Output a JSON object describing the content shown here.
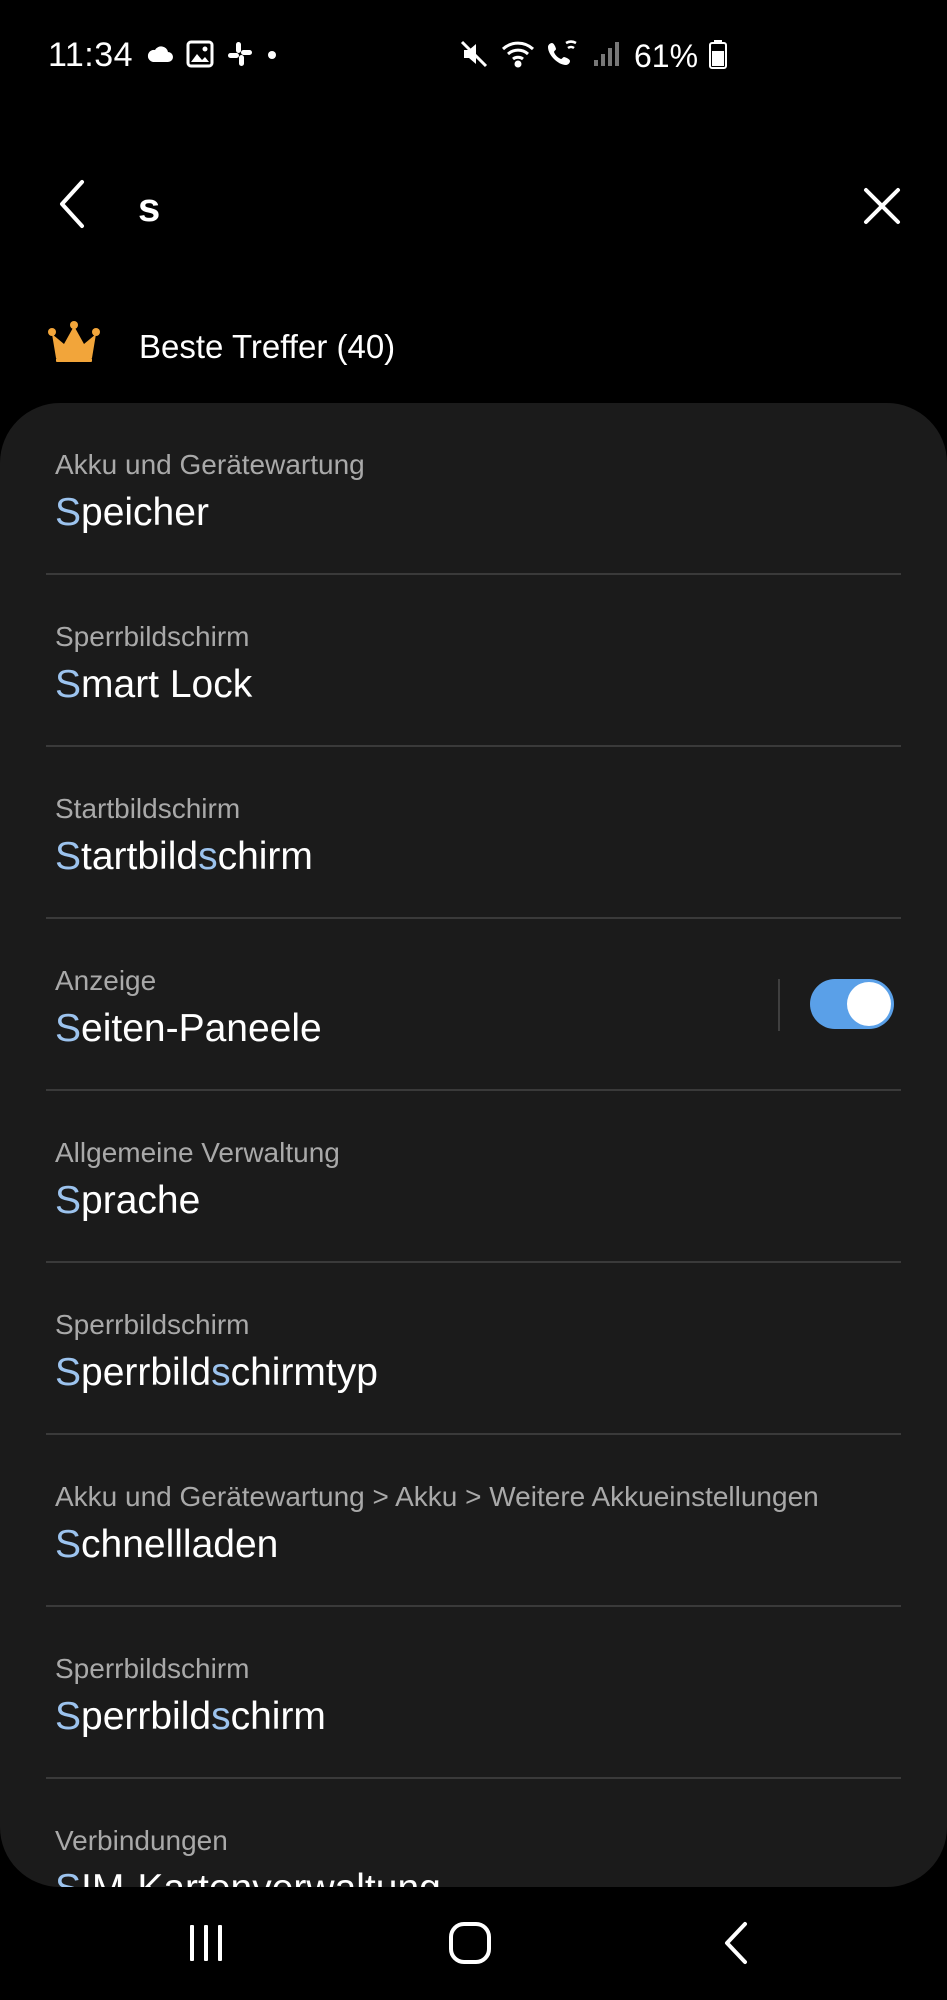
{
  "status_bar": {
    "time": "11:34",
    "battery": "61%",
    "icons_left": [
      "cloud-icon",
      "gallery-icon",
      "slack-icon",
      "dot-icon"
    ],
    "icons_right": [
      "mute-icon",
      "wifi-icon",
      "wifi-call-icon",
      "signal-icon",
      "battery-icon"
    ]
  },
  "search": {
    "query": "s",
    "back_icon": "chevron-left-icon",
    "clear_icon": "close-icon"
  },
  "best_results": {
    "icon": "crown-icon",
    "label": "Beste Treffer (40)"
  },
  "colors": {
    "highlight": "#9cc3ee",
    "toggle_on": "#5aa0e8",
    "crown": "#f2a53a",
    "card_bg": "#1b1b1b"
  },
  "results": [
    {
      "path": "Akku und Gerätewartung",
      "title": [
        {
          "t": "S",
          "h": true
        },
        {
          "t": "peicher",
          "h": false
        }
      ]
    },
    {
      "path": "Sperrbildschirm",
      "title": [
        {
          "t": "S",
          "h": true
        },
        {
          "t": "mart Lock",
          "h": false
        }
      ]
    },
    {
      "path": "Startbildschirm",
      "title": [
        {
          "t": "S",
          "h": true
        },
        {
          "t": "tartbild",
          "h": false
        },
        {
          "t": "s",
          "h": true
        },
        {
          "t": "chirm",
          "h": false
        }
      ]
    },
    {
      "path": "Anzeige",
      "title": [
        {
          "t": "S",
          "h": true
        },
        {
          "t": "eiten-Paneele",
          "h": false
        }
      ],
      "toggle": true
    },
    {
      "path": "Allgemeine Verwaltung",
      "title": [
        {
          "t": "S",
          "h": true
        },
        {
          "t": "prache",
          "h": false
        }
      ]
    },
    {
      "path": "Sperrbildschirm",
      "title": [
        {
          "t": "S",
          "h": true
        },
        {
          "t": "perrbild",
          "h": false
        },
        {
          "t": "s",
          "h": true
        },
        {
          "t": "chirmtyp",
          "h": false
        }
      ]
    },
    {
      "path": "Akku und Gerätewartung > Akku > Weitere Akkueinstellungen",
      "title": [
        {
          "t": "S",
          "h": true
        },
        {
          "t": "chnellladen",
          "h": false
        }
      ]
    },
    {
      "path": "Sperrbildschirm",
      "title": [
        {
          "t": "S",
          "h": true
        },
        {
          "t": "perrbild",
          "h": false
        },
        {
          "t": "s",
          "h": true
        },
        {
          "t": "chirm",
          "h": false
        }
      ]
    },
    {
      "path": "Verbindungen",
      "title": [
        {
          "t": "S",
          "h": true
        },
        {
          "t": "IM-Kartenverwaltung",
          "h": false
        }
      ]
    }
  ],
  "nav": {
    "recents_icon": "recents-icon",
    "home_icon": "home-icon",
    "back_icon": "back-icon"
  }
}
